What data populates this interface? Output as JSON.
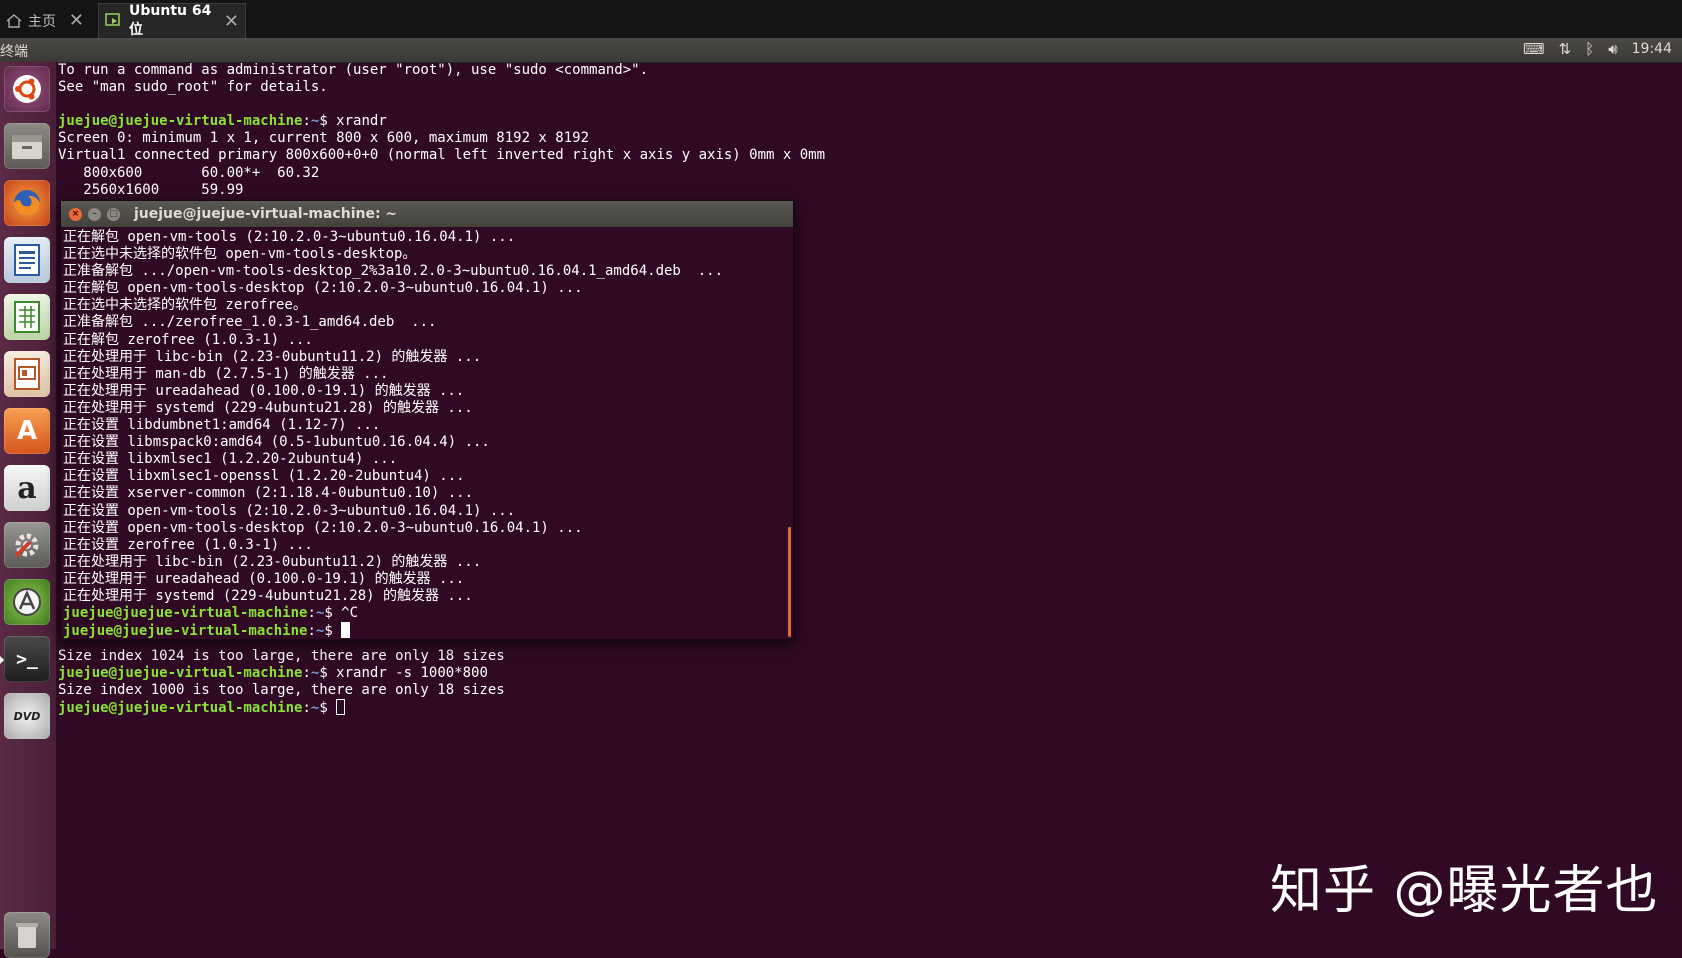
{
  "vm_tabs": {
    "home": {
      "label": "主页",
      "close": "✕"
    },
    "ubuntu": {
      "label": "Ubuntu 64 位",
      "close": "✕"
    }
  },
  "panel": {
    "title": "终端",
    "clock": "19:44"
  },
  "terminal_bg": {
    "lines_top": [
      "To run a command as administrator (user \"root\"), use \"sudo <command>\".",
      "See \"man sudo_root\" for details.",
      ""
    ],
    "prompt_user": "juejue@juejue-virtual-machine",
    "prompt_sep": ":",
    "prompt_path": "~",
    "prompt_sign": "$ ",
    "cmd1": "xrandr",
    "xrandr_out": [
      "Screen 0: minimum 1 x 1, current 800 x 600, maximum 8192 x 8192",
      "Virtual1 connected primary 800x600+0+0 (normal left inverted right x axis y axis) 0mm x 0mm",
      "   800x600       60.00*+  60.32",
      "   2560x1600     59.99"
    ],
    "lines_bottom": [
      "Size index 1024 is too large, there are only 18 sizes"
    ],
    "cmd2": "xrandr -s 1000*800",
    "line_last": "Size index 1000 is too large, there are only 18 sizes"
  },
  "term_window": {
    "title": "juejue@juejue-virtual-machine: ~",
    "lines": [
      "正在解包 open-vm-tools (2:10.2.0-3~ubuntu0.16.04.1) ...",
      "正在选中未选择的软件包 open-vm-tools-desktop。",
      "正准备解包 .../open-vm-tools-desktop_2%3a10.2.0-3~ubuntu0.16.04.1_amd64.deb  ...",
      "正在解包 open-vm-tools-desktop (2:10.2.0-3~ubuntu0.16.04.1) ...",
      "正在选中未选择的软件包 zerofree。",
      "正准备解包 .../zerofree_1.0.3-1_amd64.deb  ...",
      "正在解包 zerofree (1.0.3-1) ...",
      "正在处理用于 libc-bin (2.23-0ubuntu11.2) 的触发器 ...",
      "正在处理用于 man-db (2.7.5-1) 的触发器 ...",
      "正在处理用于 ureadahead (0.100.0-19.1) 的触发器 ...",
      "正在处理用于 systemd (229-4ubuntu21.28) 的触发器 ...",
      "正在设置 libdumbnet1:amd64 (1.12-7) ...",
      "正在设置 libmspack0:amd64 (0.5-1ubuntu0.16.04.4) ...",
      "正在设置 libxmlsec1 (1.2.20-2ubuntu4) ...",
      "正在设置 libxmlsec1-openssl (1.2.20-2ubuntu4) ...",
      "正在设置 xserver-common (2:1.18.4-0ubuntu0.10) ...",
      "正在设置 open-vm-tools (2:10.2.0-3~ubuntu0.16.04.1) ...",
      "正在设置 open-vm-tools-desktop (2:10.2.0-3~ubuntu0.16.04.1) ...",
      "正在设置 zerofree (1.0.3-1) ...",
      "正在处理用于 libc-bin (2.23-0ubuntu11.2) 的触发器 ...",
      "正在处理用于 ureadahead (0.100.0-19.1) 的触发器 ...",
      "正在处理用于 systemd (229-4ubuntu21.28) 的触发器 ..."
    ],
    "cmd_ctrlc": "^C"
  },
  "launcher_icons": [
    "ubuntu-dash-icon",
    "files-icon",
    "firefox-icon",
    "writer-icon",
    "calc-icon",
    "impress-icon",
    "software-center-icon",
    "amazon-icon",
    "settings-icon",
    "updater-icon",
    "terminal-icon",
    "dvd-icon",
    "trash-icon"
  ],
  "launcher_glyphs": {
    "amazon": "a",
    "dvd": "DVD",
    "software": "A",
    "terminal": ">_"
  },
  "watermark": "知乎 @曝光者也"
}
